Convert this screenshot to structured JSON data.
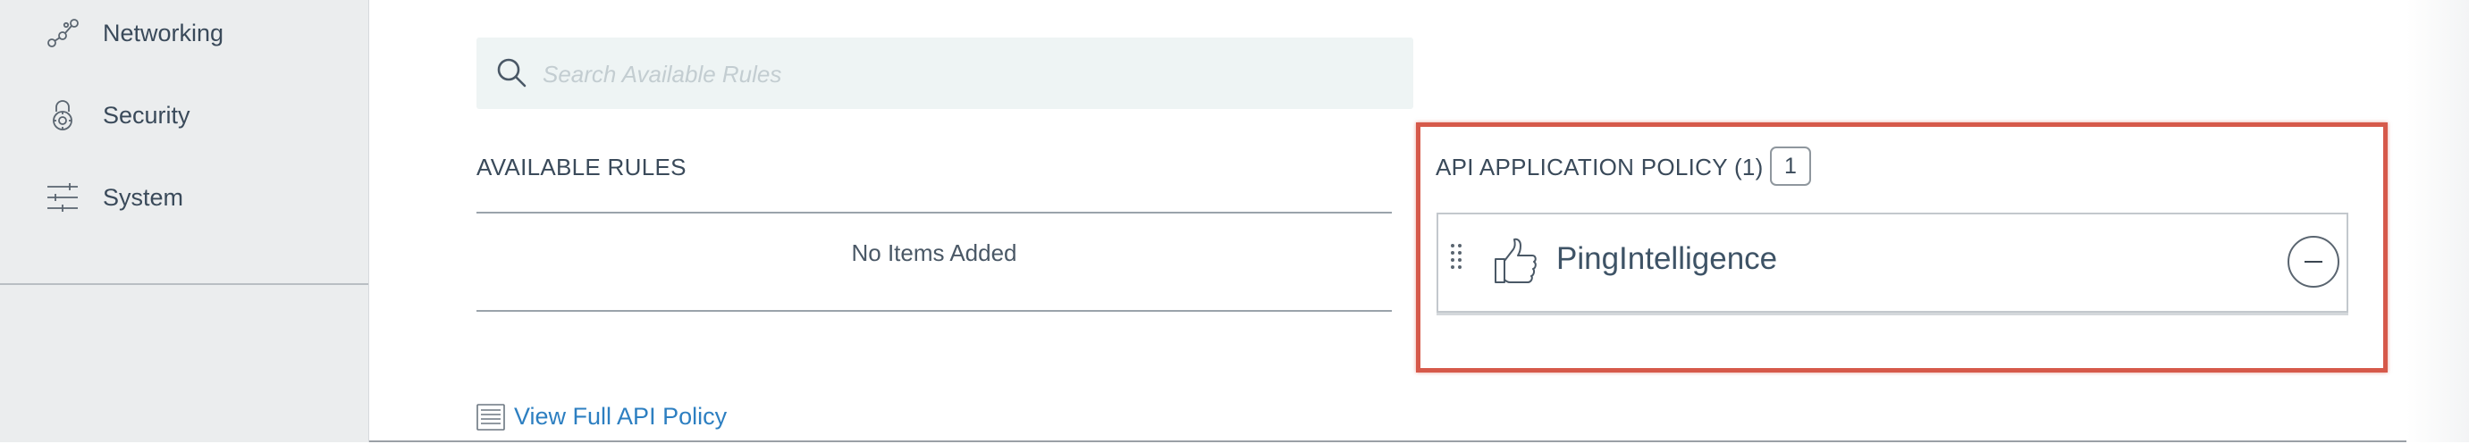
{
  "sidebar": {
    "items": [
      {
        "label": "Networking",
        "icon": "network-nodes-icon"
      },
      {
        "label": "Security",
        "icon": "lock-gear-icon"
      },
      {
        "label": "System",
        "icon": "sliders-icon"
      }
    ]
  },
  "search": {
    "placeholder": "Search Available Rules",
    "value": ""
  },
  "available_rules": {
    "title": "AVAILABLE RULES",
    "empty_message": "No Items Added"
  },
  "policy": {
    "title": "API APPLICATION POLICY (1)",
    "count_badge": "1",
    "items": [
      {
        "name": "PingIntelligence",
        "icon": "thumbs-up-icon",
        "action_icon": "minus-circle-icon"
      }
    ]
  },
  "view_policy_link": {
    "label": "View Full API Policy",
    "icon": "document-lines-icon"
  },
  "colors": {
    "highlight": "#d6594a",
    "link": "#2d7fc1",
    "search_bg": "#eef4f4",
    "sidebar_bg": "#ebedee"
  }
}
